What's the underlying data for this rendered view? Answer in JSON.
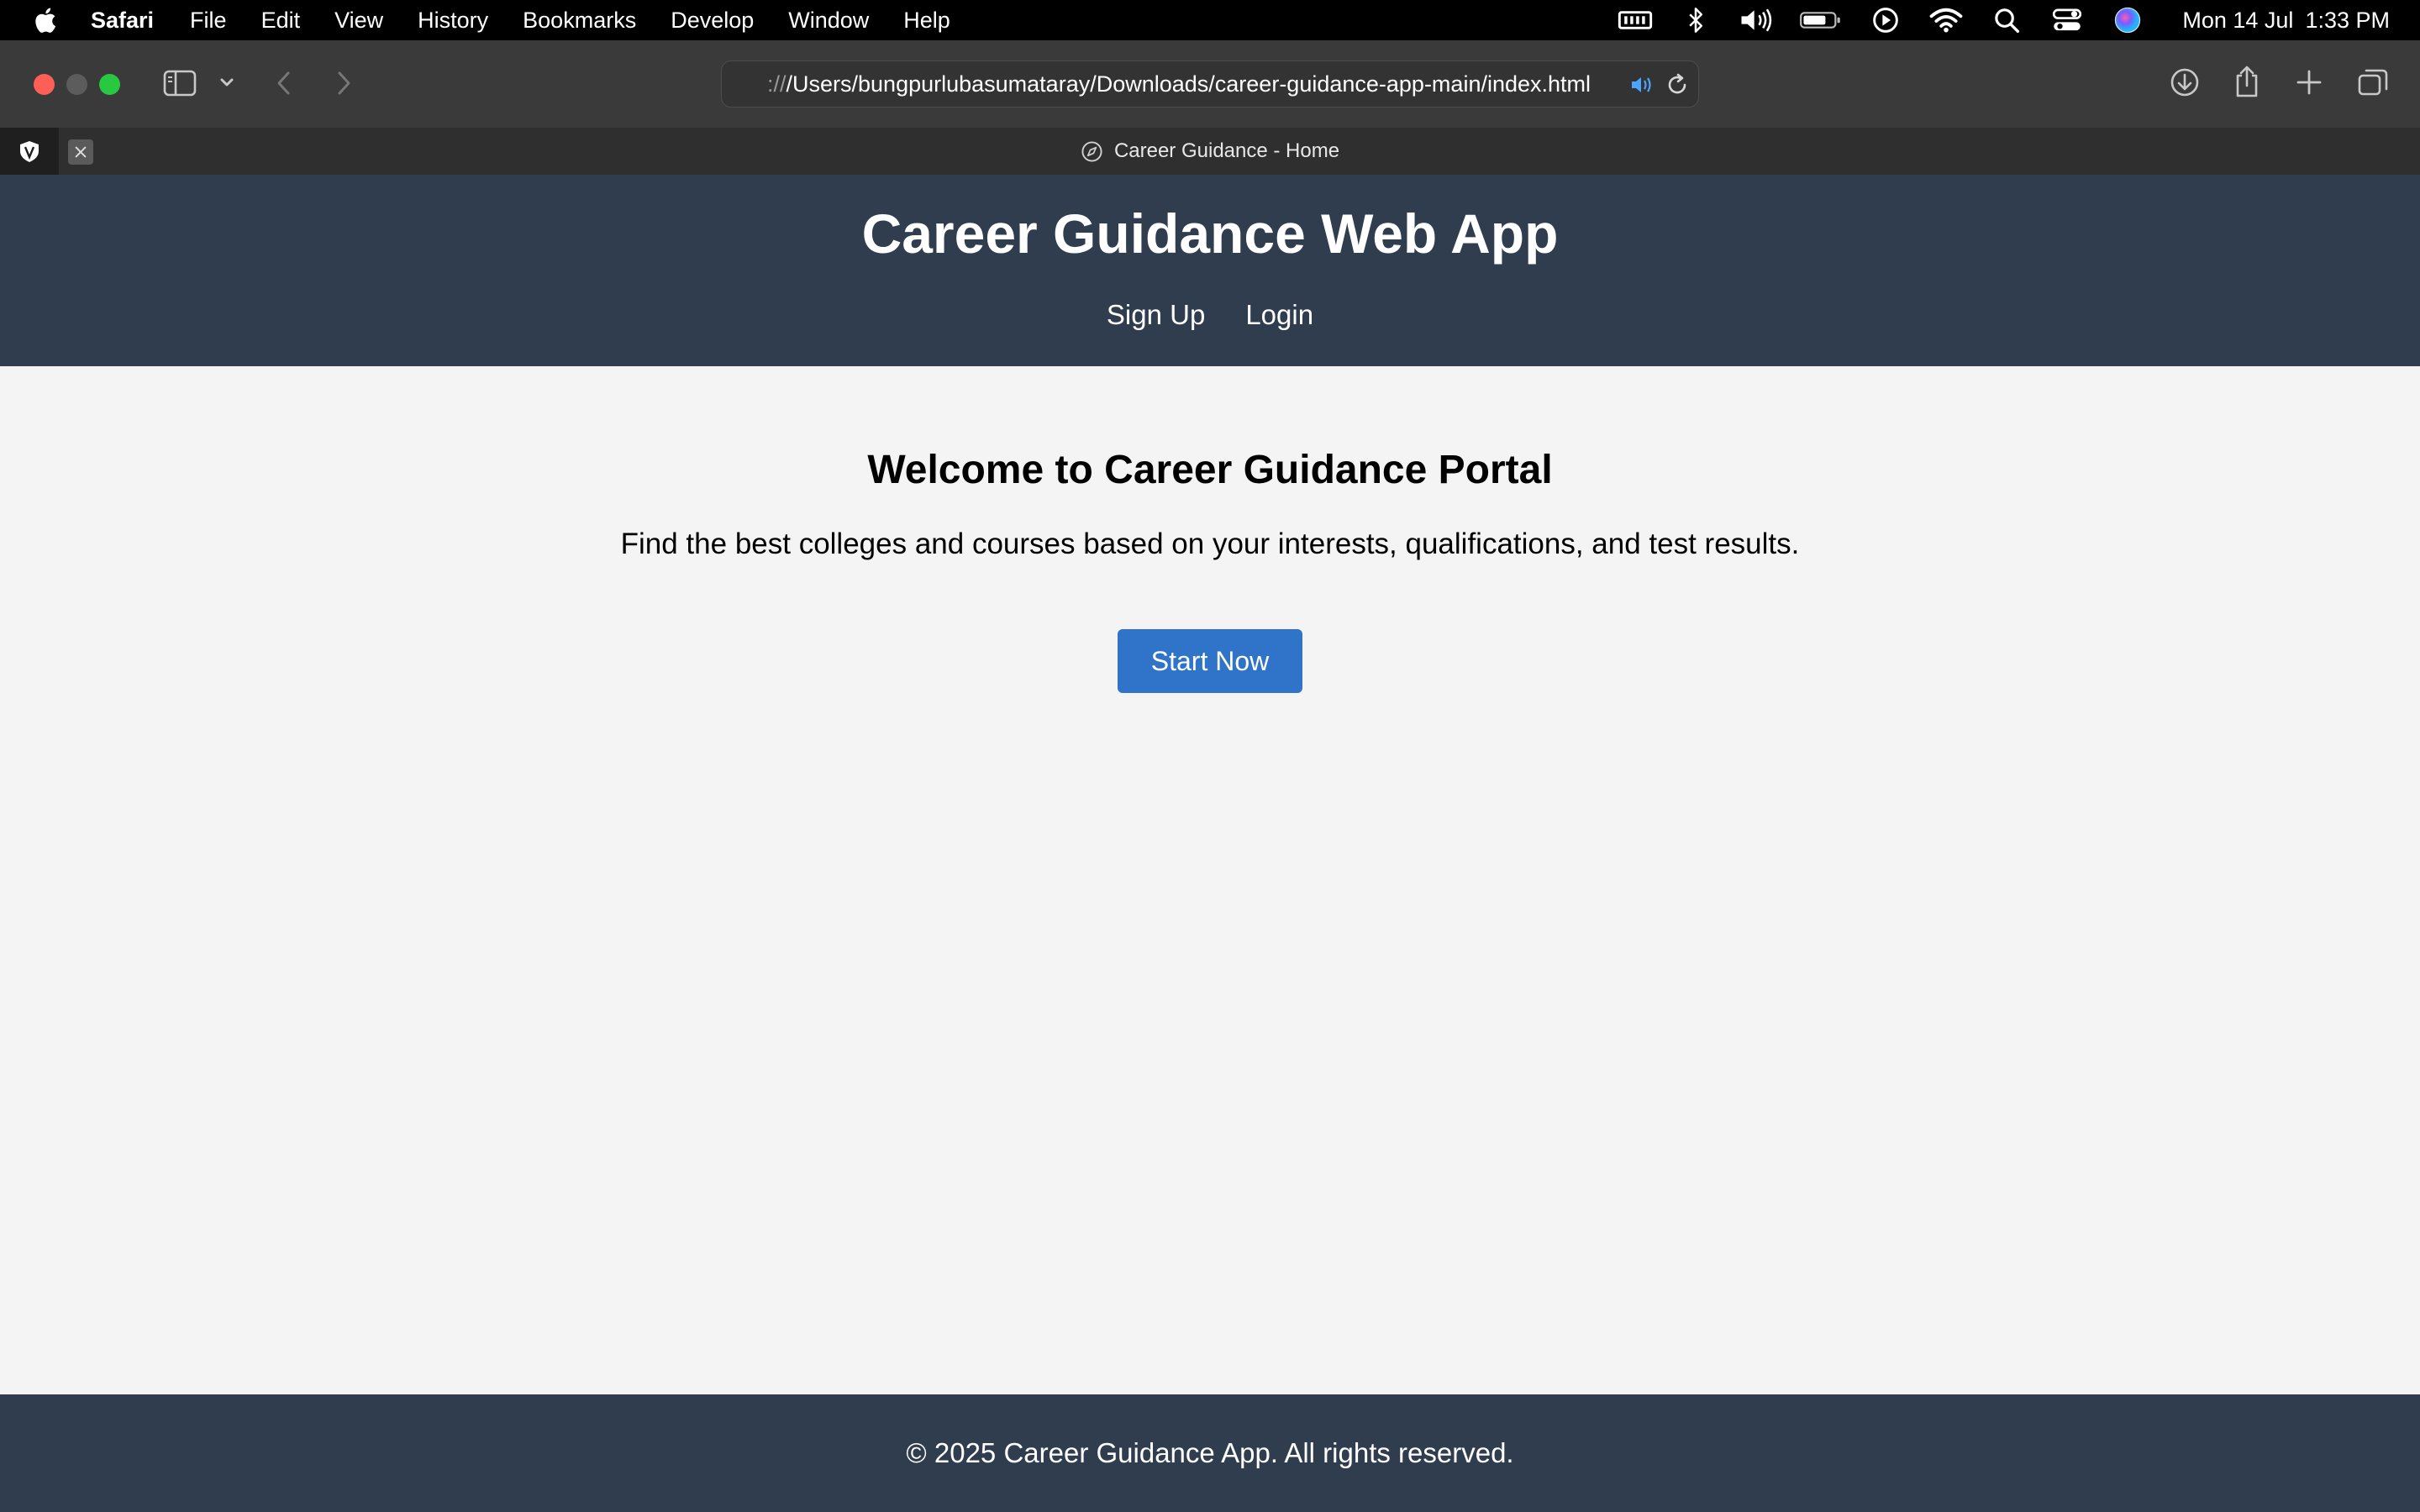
{
  "menubar": {
    "app_name": "Safari",
    "items": [
      "File",
      "Edit",
      "View",
      "History",
      "Bookmarks",
      "Develop",
      "Window",
      "Help"
    ],
    "clock_date": "Mon 14 Jul",
    "clock_time": "1:33 PM"
  },
  "browser": {
    "url_prefix": "://",
    "url_path": "/Users/bungpurlubasumataray/Downloads/career-guidance-app-main/index.html",
    "tab_title": "Career Guidance - Home"
  },
  "page": {
    "site_title": "Career Guidance Web App",
    "nav": {
      "signup": "Sign Up",
      "login": "Login"
    },
    "welcome_heading": "Welcome to Career Guidance Portal",
    "tagline": "Find the best colleges and courses based on your interests, qualifications, and test results.",
    "cta_label": "Start Now",
    "footer_text": "© 2025 Career Guidance App. All rights reserved."
  },
  "colors": {
    "header_bg": "#2f3d4f",
    "page_bg": "#f4f4f4",
    "button_bg": "#2f74c8"
  }
}
